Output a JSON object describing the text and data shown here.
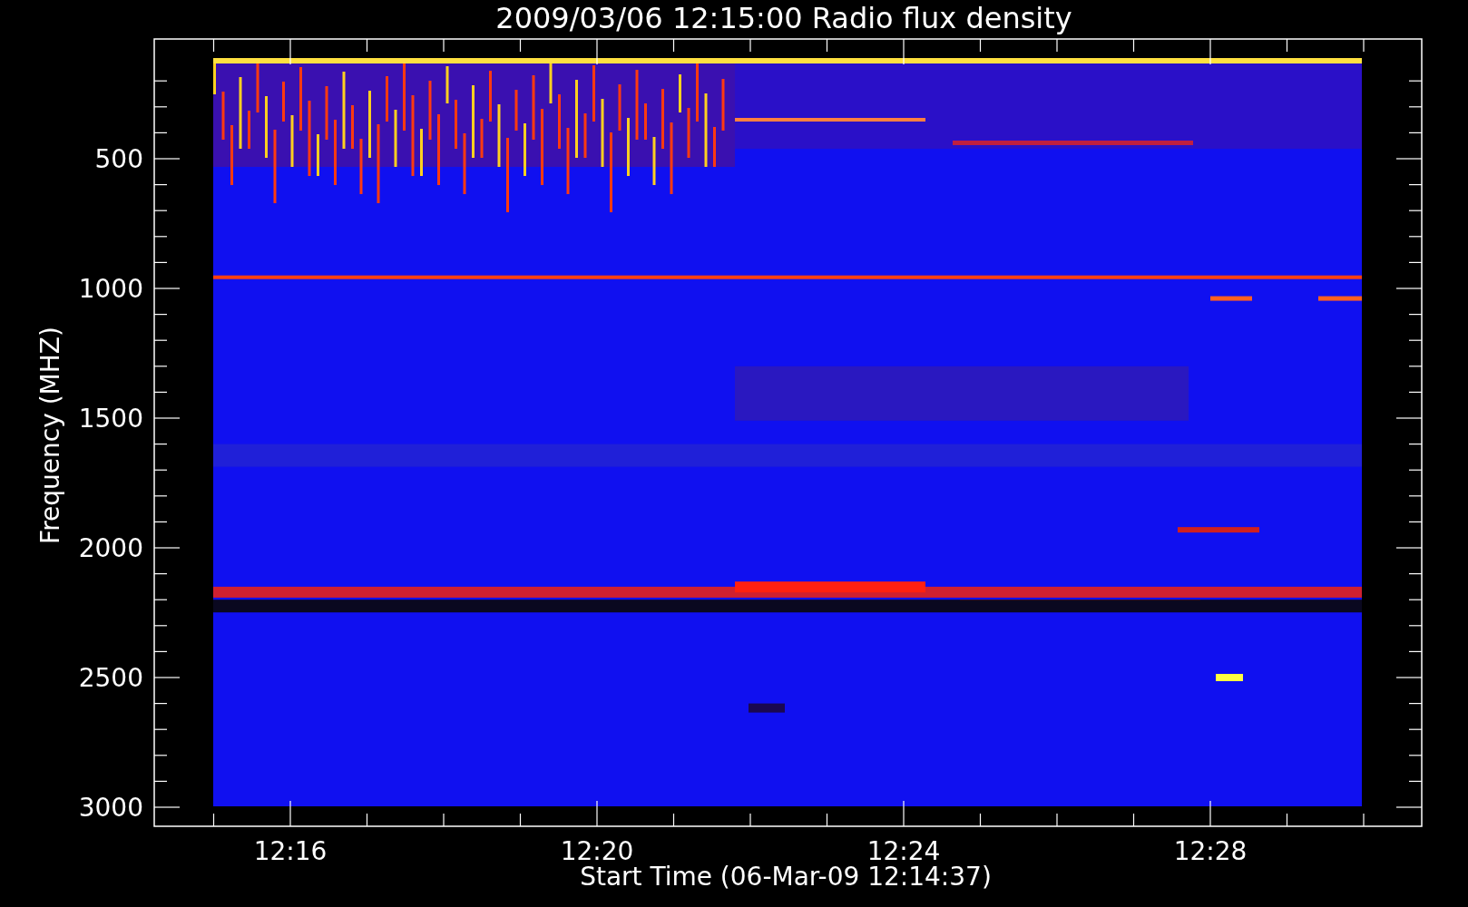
{
  "title": "2009/03/06 12:15:00 Radio flux density",
  "plot": {
    "ylabel": "Frequency (MHZ)",
    "xlabel": "Start Time (06-Mar-09 12:14:37)",
    "yticks": [
      "500",
      "1000",
      "1500",
      "2000",
      "2500",
      "3000"
    ],
    "xticks": [
      "12:16",
      "12:20",
      "12:24",
      "12:28"
    ]
  }
}
